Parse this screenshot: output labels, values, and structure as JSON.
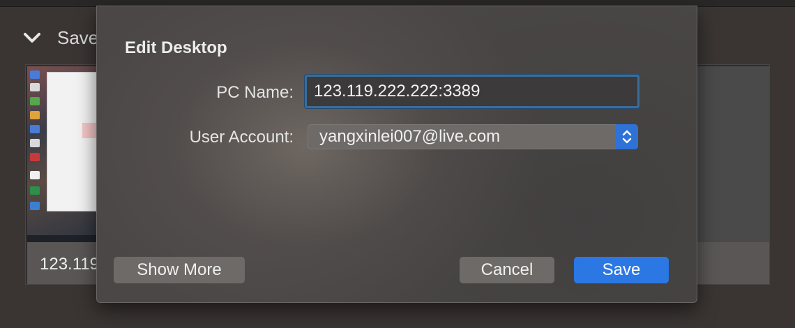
{
  "background": {
    "section_label": "Saved",
    "thumbnail_title": "123.119.222.222:3389"
  },
  "dialog": {
    "title": "Edit Desktop",
    "pc_name_label": "PC Name:",
    "pc_name_value": "123.119.222.222:3389",
    "user_account_label": "User Account:",
    "user_account_value": "yangxinlei007@live.com",
    "show_more_label": "Show More",
    "cancel_label": "Cancel",
    "save_label": "Save"
  },
  "colors": {
    "accent": "#2b78e4",
    "focus_ring": "#3a6d9a",
    "dialog_bg": "#4b4747"
  },
  "icons": {
    "section_toggle": "chevron-down-icon",
    "select_stepper": "up-down-stepper-icon"
  }
}
